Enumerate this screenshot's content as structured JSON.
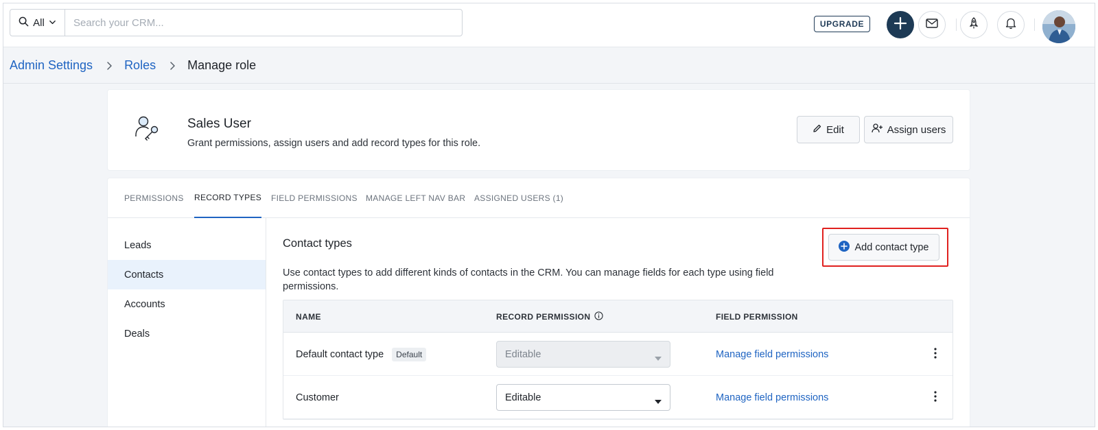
{
  "topbar": {
    "search_scope": "All",
    "search_placeholder": "Search your CRM...",
    "upgrade_label": "UPGRADE"
  },
  "breadcrumb": {
    "admin_settings": "Admin Settings",
    "roles": "Roles",
    "current": "Manage role"
  },
  "role": {
    "name": "Sales User",
    "description": "Grant permissions, assign users and add record types for this role.",
    "edit_label": "Edit",
    "assign_users_label": "Assign users"
  },
  "tabs": [
    {
      "label": "PERMISSIONS"
    },
    {
      "label": "RECORD TYPES"
    },
    {
      "label": "FIELD PERMISSIONS"
    },
    {
      "label": "MANAGE LEFT NAV BAR"
    },
    {
      "label": "ASSIGNED USERS (1)"
    }
  ],
  "active_tab": "RECORD TYPES",
  "side_nav": [
    {
      "label": "Leads"
    },
    {
      "label": "Contacts"
    },
    {
      "label": "Accounts"
    },
    {
      "label": "Deals"
    }
  ],
  "active_side_item": "Contacts",
  "section": {
    "title": "Contact types",
    "description": "Use contact types to add different kinds of contacts in the CRM. You can manage fields for each type using field permissions.",
    "add_button_label": "Add contact type"
  },
  "table": {
    "headers": {
      "name": "NAME",
      "record_permission": "RECORD PERMISSION",
      "field_permission": "FIELD PERMISSION"
    },
    "rows": [
      {
        "name": "Default contact type",
        "badge": "Default",
        "permission": "Editable",
        "permission_disabled": true,
        "link": "Manage field permissions"
      },
      {
        "name": "Customer",
        "badge": "",
        "permission": "Editable",
        "permission_disabled": false,
        "link": "Manage field permissions"
      }
    ]
  },
  "colors": {
    "accent": "#1f64c2",
    "brand_dark": "#1d3a55",
    "highlight": "#e0201e",
    "active_nav_bg": "#e9f2fc"
  }
}
